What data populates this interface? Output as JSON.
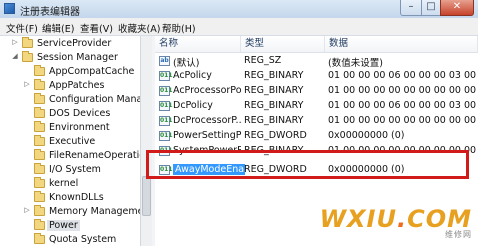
{
  "window": {
    "title": "注册表编辑器",
    "controls": {
      "minimize": "–",
      "maximize": "□",
      "close": "✕"
    }
  },
  "menu": [
    "文件(F)",
    "编辑(E)",
    "查看(V)",
    "收藏夹(A)",
    "帮助(H)"
  ],
  "tree": {
    "items": [
      {
        "label": "ServiceProvider",
        "expander": "▷"
      },
      {
        "label": "Session Manager",
        "expander": "◢"
      },
      {
        "label": "AppCompatCache",
        "expander": ""
      },
      {
        "label": "AppPatches",
        "expander": "▷"
      },
      {
        "label": "Configuration Mana",
        "expander": ""
      },
      {
        "label": "DOS Devices",
        "expander": ""
      },
      {
        "label": "Environment",
        "expander": ""
      },
      {
        "label": "Executive",
        "expander": ""
      },
      {
        "label": "FileRenameOperatic",
        "expander": ""
      },
      {
        "label": "I/O System",
        "expander": ""
      },
      {
        "label": "kernel",
        "expander": ""
      },
      {
        "label": "KnownDLLs",
        "expander": ""
      },
      {
        "label": "Memory Manageme",
        "expander": "▷"
      },
      {
        "label": "Power",
        "expander": "",
        "selected": true
      },
      {
        "label": "Quota System",
        "expander": ""
      }
    ]
  },
  "list": {
    "columns": [
      "名称",
      "类型",
      "数据"
    ],
    "rows": [
      {
        "icon": "ab",
        "name": "(默认)",
        "type": "REG_SZ",
        "data": "(数值未设置)"
      },
      {
        "icon": "011",
        "name": "AcPolicy",
        "type": "REG_BINARY",
        "data": "01 00 00 00 06 00 00 00 03 00 00 00"
      },
      {
        "icon": "011",
        "name": "AcProcessorPo...",
        "type": "REG_BINARY",
        "data": "01 00 00 00 00 00 00 00 00 00 00 00"
      },
      {
        "icon": "011",
        "name": "DcPolicy",
        "type": "REG_BINARY",
        "data": "01 00 00 00 06 00 00 00 03 00 00 00"
      },
      {
        "icon": "011",
        "name": "DcProcessorP...",
        "type": "REG_BINARY",
        "data": "01 00 00 00 00 00 00 00 00 00 00 00"
      },
      {
        "icon": "011",
        "name": "PowerSettingP...",
        "type": "REG_DWORD",
        "data": "0x00000000 (0)"
      },
      {
        "icon": "011",
        "name": "SystemPowerP...",
        "type": "REG_BINARY",
        "data": "01 00 00 00 00 00 00 00 00 00 00 00"
      },
      {
        "icon": "011",
        "name": "AwayModeEna...",
        "type": "REG_DWORD",
        "data": "0x00000000 (0)",
        "selected": true
      }
    ]
  },
  "watermark": {
    "logo": "WXIU",
    "dot": ".",
    "suffix": "COM",
    "sub": "维修网"
  }
}
